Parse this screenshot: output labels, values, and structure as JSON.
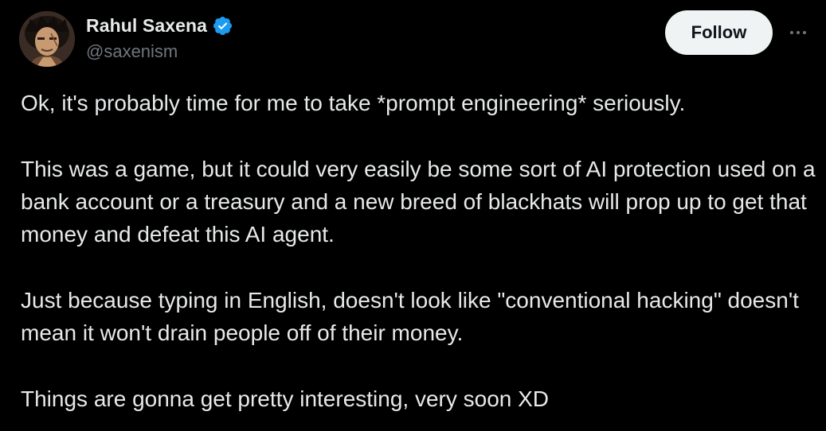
{
  "author": {
    "display_name": "Rahul Saxena",
    "handle": "@saxenism",
    "verified": true,
    "avatar_icon": "avatar-illustrated-character-icon"
  },
  "actions": {
    "follow_label": "Follow",
    "more_icon": "more-options-icon"
  },
  "tweet": {
    "paragraphs": [
      "Ok, it's probably time for me to take *prompt engineering* seriously.",
      "This was a game, but it could very easily be some sort of AI protection used on a bank account or a treasury and a new breed of blackhats will prop up to get that money and defeat this AI agent.",
      "Just because typing in English, doesn't look like \"conventional hacking\" doesn't mean it won't drain people off of their money.",
      "Things are gonna get pretty interesting, very soon XD"
    ]
  },
  "colors": {
    "background": "#000000",
    "text_primary": "#e7e9ea",
    "text_secondary": "#71767b",
    "verified_blue": "#1d9bf0",
    "follow_bg": "#eff3f4",
    "follow_text": "#0f1419"
  }
}
